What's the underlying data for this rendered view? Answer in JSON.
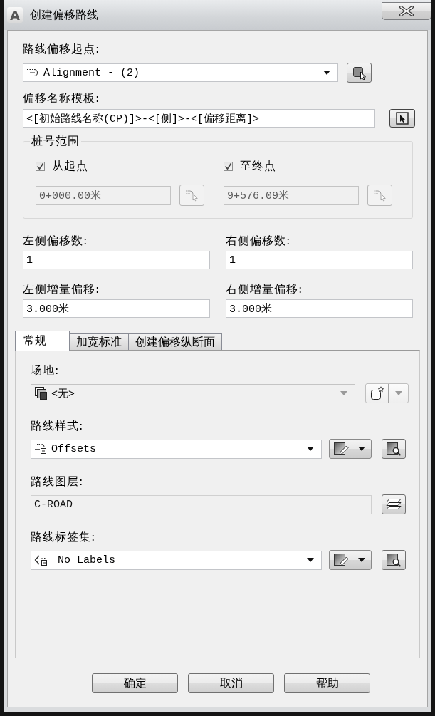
{
  "window": {
    "logo": "A",
    "title": "创建偏移路线"
  },
  "start_alignment": {
    "label": "路线偏移起点:",
    "value": "Alignment - (2)"
  },
  "name_template": {
    "label": "偏移名称模板:",
    "value": "<[初始路线名称(CP)]>-<[侧]>-<[偏移距离]>"
  },
  "station_range": {
    "title": "桩号范围",
    "start": {
      "label": "从起点",
      "checked": true,
      "value": "0+000.00米",
      "disabled": true
    },
    "end": {
      "label": "至终点",
      "checked": true,
      "value": "9+576.09米",
      "disabled": true
    }
  },
  "offsets": [
    {
      "label": "左侧偏移数:",
      "value": "1"
    },
    {
      "label": "右侧偏移数:",
      "value": "1"
    },
    {
      "label": "左侧增量偏移:",
      "value": "3.000米"
    },
    {
      "label": "右侧增量偏移:",
      "value": "3.000米"
    }
  ],
  "tabs": [
    {
      "label": "常规",
      "selected": true
    },
    {
      "label": "加宽标准",
      "selected": false
    },
    {
      "label": "创建偏移纵断面",
      "selected": false
    }
  ],
  "general": [
    {
      "kind": "site",
      "label": "场地:",
      "value": "<无>",
      "disabled": true
    },
    {
      "kind": "style",
      "label": "路线样式:",
      "value": "Offsets",
      "disabled": false
    },
    {
      "kind": "layer",
      "label": "路线图层:",
      "value": "C-ROAD",
      "disabled": true
    },
    {
      "kind": "labelset",
      "label": "路线标签集:",
      "value": "_No Labels",
      "disabled": false
    }
  ],
  "buttons": [
    "确定",
    "取消",
    "帮助"
  ]
}
